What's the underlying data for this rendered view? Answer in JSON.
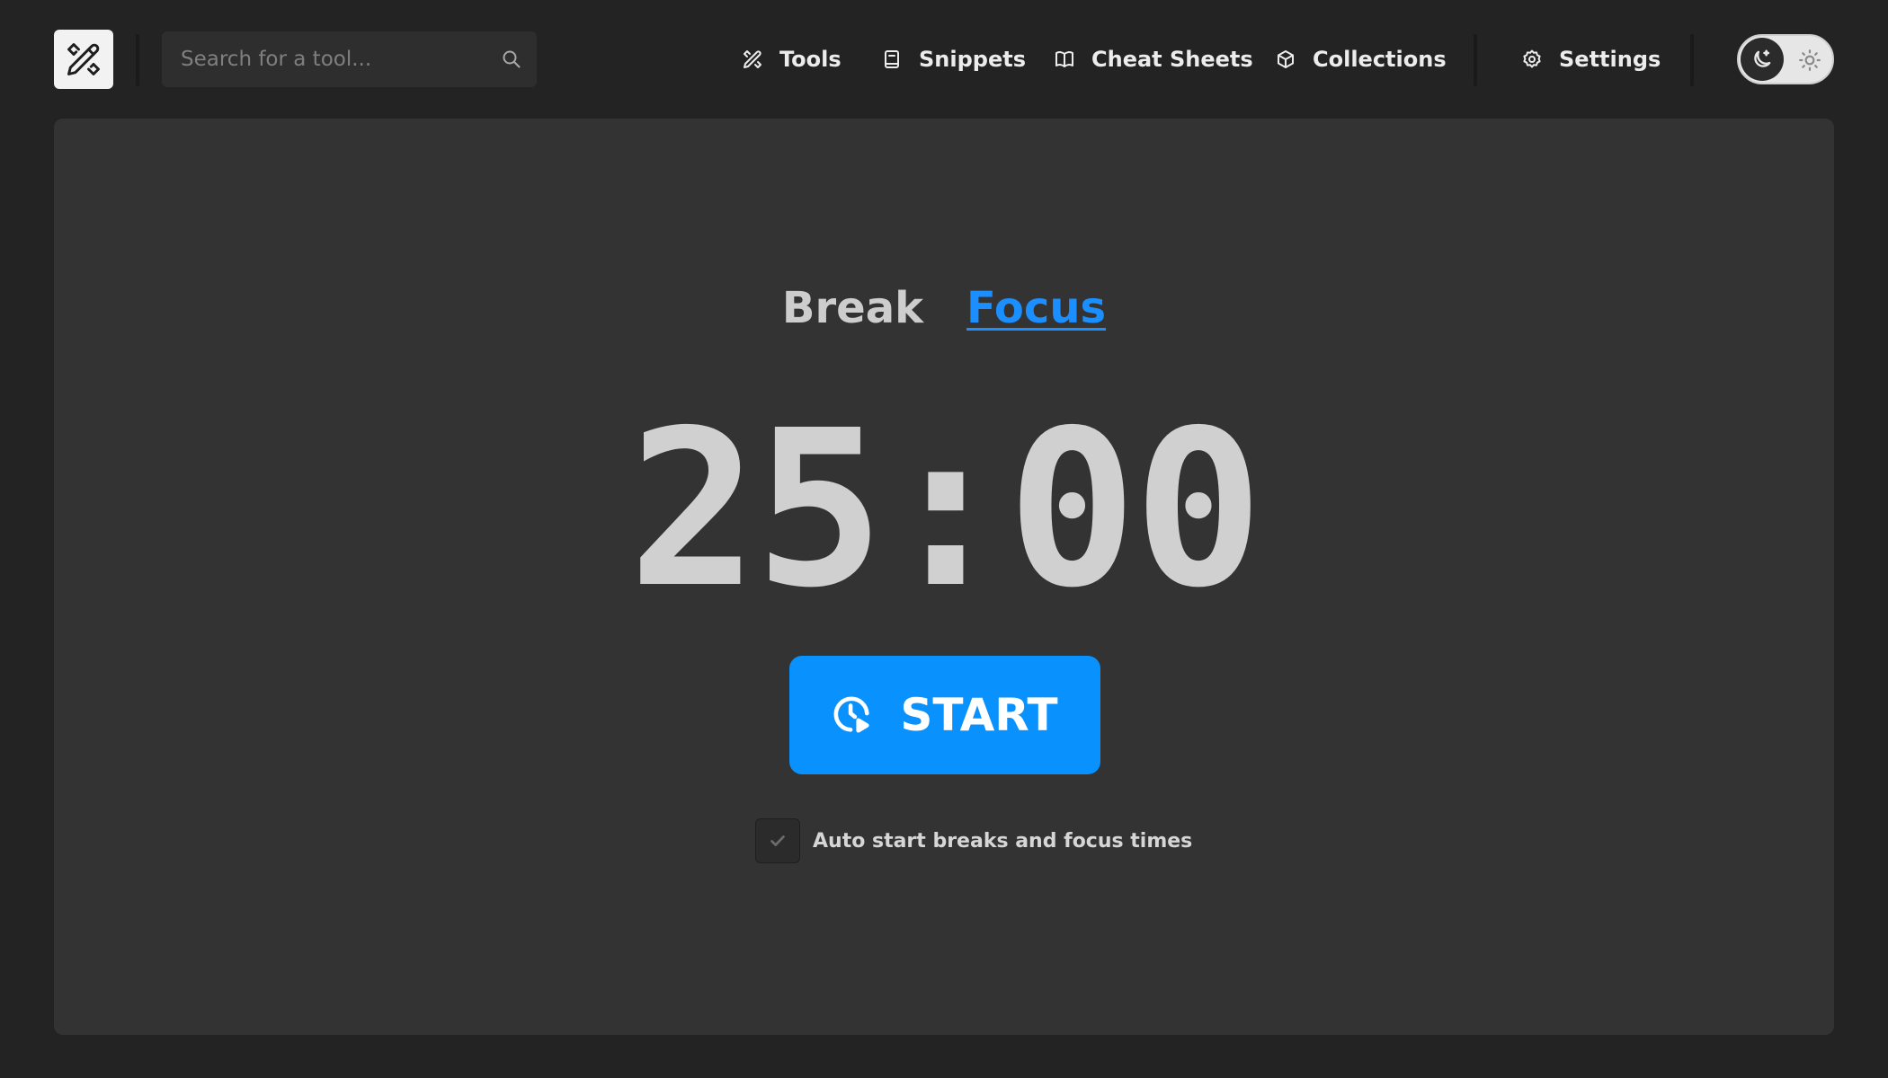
{
  "header": {
    "search": {
      "placeholder": "Search for a tool..."
    },
    "nav": [
      {
        "label": "Tools",
        "icon": "tools-icon"
      },
      {
        "label": "Snippets",
        "icon": "snippet-icon"
      },
      {
        "label": "Cheat Sheets",
        "icon": "book-icon"
      },
      {
        "label": "Collections",
        "icon": "cube-icon"
      },
      {
        "label": "Settings",
        "icon": "gear-icon"
      }
    ],
    "theme": {
      "mode": "dark"
    }
  },
  "pomodoro": {
    "modes": {
      "break": "Break",
      "focus": "Focus",
      "active": "focus"
    },
    "time": "25:00",
    "start_label": "START",
    "auto_start_label": "Auto start breaks and focus times",
    "auto_start_checked": false
  },
  "colors": {
    "accent": "#0991fd",
    "background": "#232323",
    "panel": "#333333"
  }
}
